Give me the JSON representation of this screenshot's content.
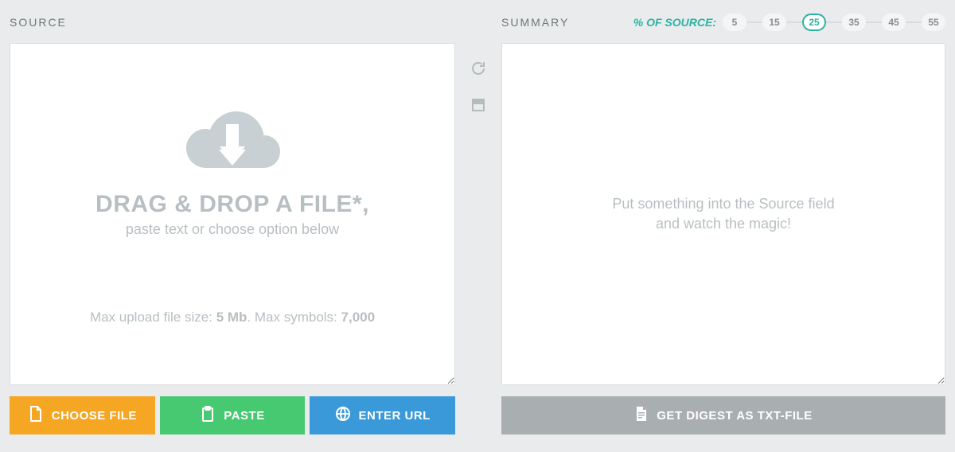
{
  "source": {
    "label": "SOURCE",
    "drop_title": "DRAG & DROP A FILE*,",
    "drop_sub": "paste text or choose option below",
    "max_prefix": "Max upload file size: ",
    "max_size": "5 Mb",
    "max_mid": ". Max symbols: ",
    "max_symbols": "7,000",
    "buttons": {
      "choose_file": "CHOOSE FILE",
      "paste": "PASTE",
      "enter_url": "ENTER URL"
    }
  },
  "summary": {
    "label": "SUMMARY",
    "percent_label": "% OF SOURCE:",
    "percent_options": [
      "5",
      "15",
      "25",
      "35",
      "45",
      "55"
    ],
    "percent_selected": "25",
    "placeholder_line1": "Put something into the Source field",
    "placeholder_line2": "and watch the magic!",
    "digest_button": "GET DIGEST AS TXT-FILE"
  },
  "icons": {
    "cloud": "cloud-download-icon",
    "refresh": "refresh-icon",
    "window": "new-window-icon",
    "file": "file-icon",
    "clipboard": "clipboard-icon",
    "globe": "globe-icon",
    "doc": "doc-icon"
  }
}
